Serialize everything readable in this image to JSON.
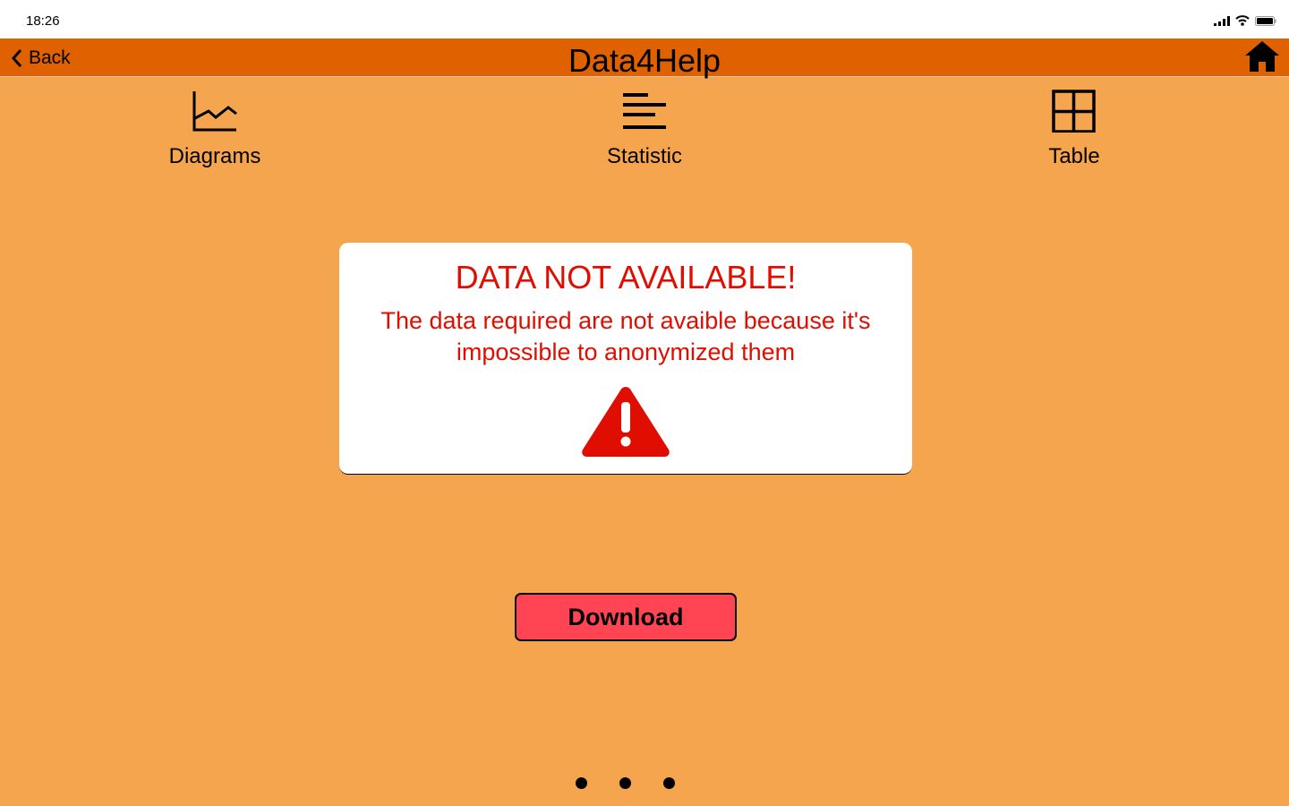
{
  "status_bar": {
    "time": "18:26"
  },
  "nav": {
    "back_label": "Back",
    "title": "Data4Help"
  },
  "tabs": [
    {
      "label": "Diagrams",
      "icon": "line-chart-icon"
    },
    {
      "label": "Statistic",
      "icon": "list-icon"
    },
    {
      "label": "Table",
      "icon": "grid-icon"
    }
  ],
  "alert": {
    "title": "DATA NOT AVAILABLE!",
    "message": "The data required are not avaible because it's impossible to anonymized them",
    "icon": "warning-icon"
  },
  "download_label": "Download",
  "page_indicator": {
    "count": 3
  },
  "colors": {
    "nav": "#E06100",
    "background": "#F5A54E",
    "error": "#E00E00",
    "button": "#FF4553"
  }
}
